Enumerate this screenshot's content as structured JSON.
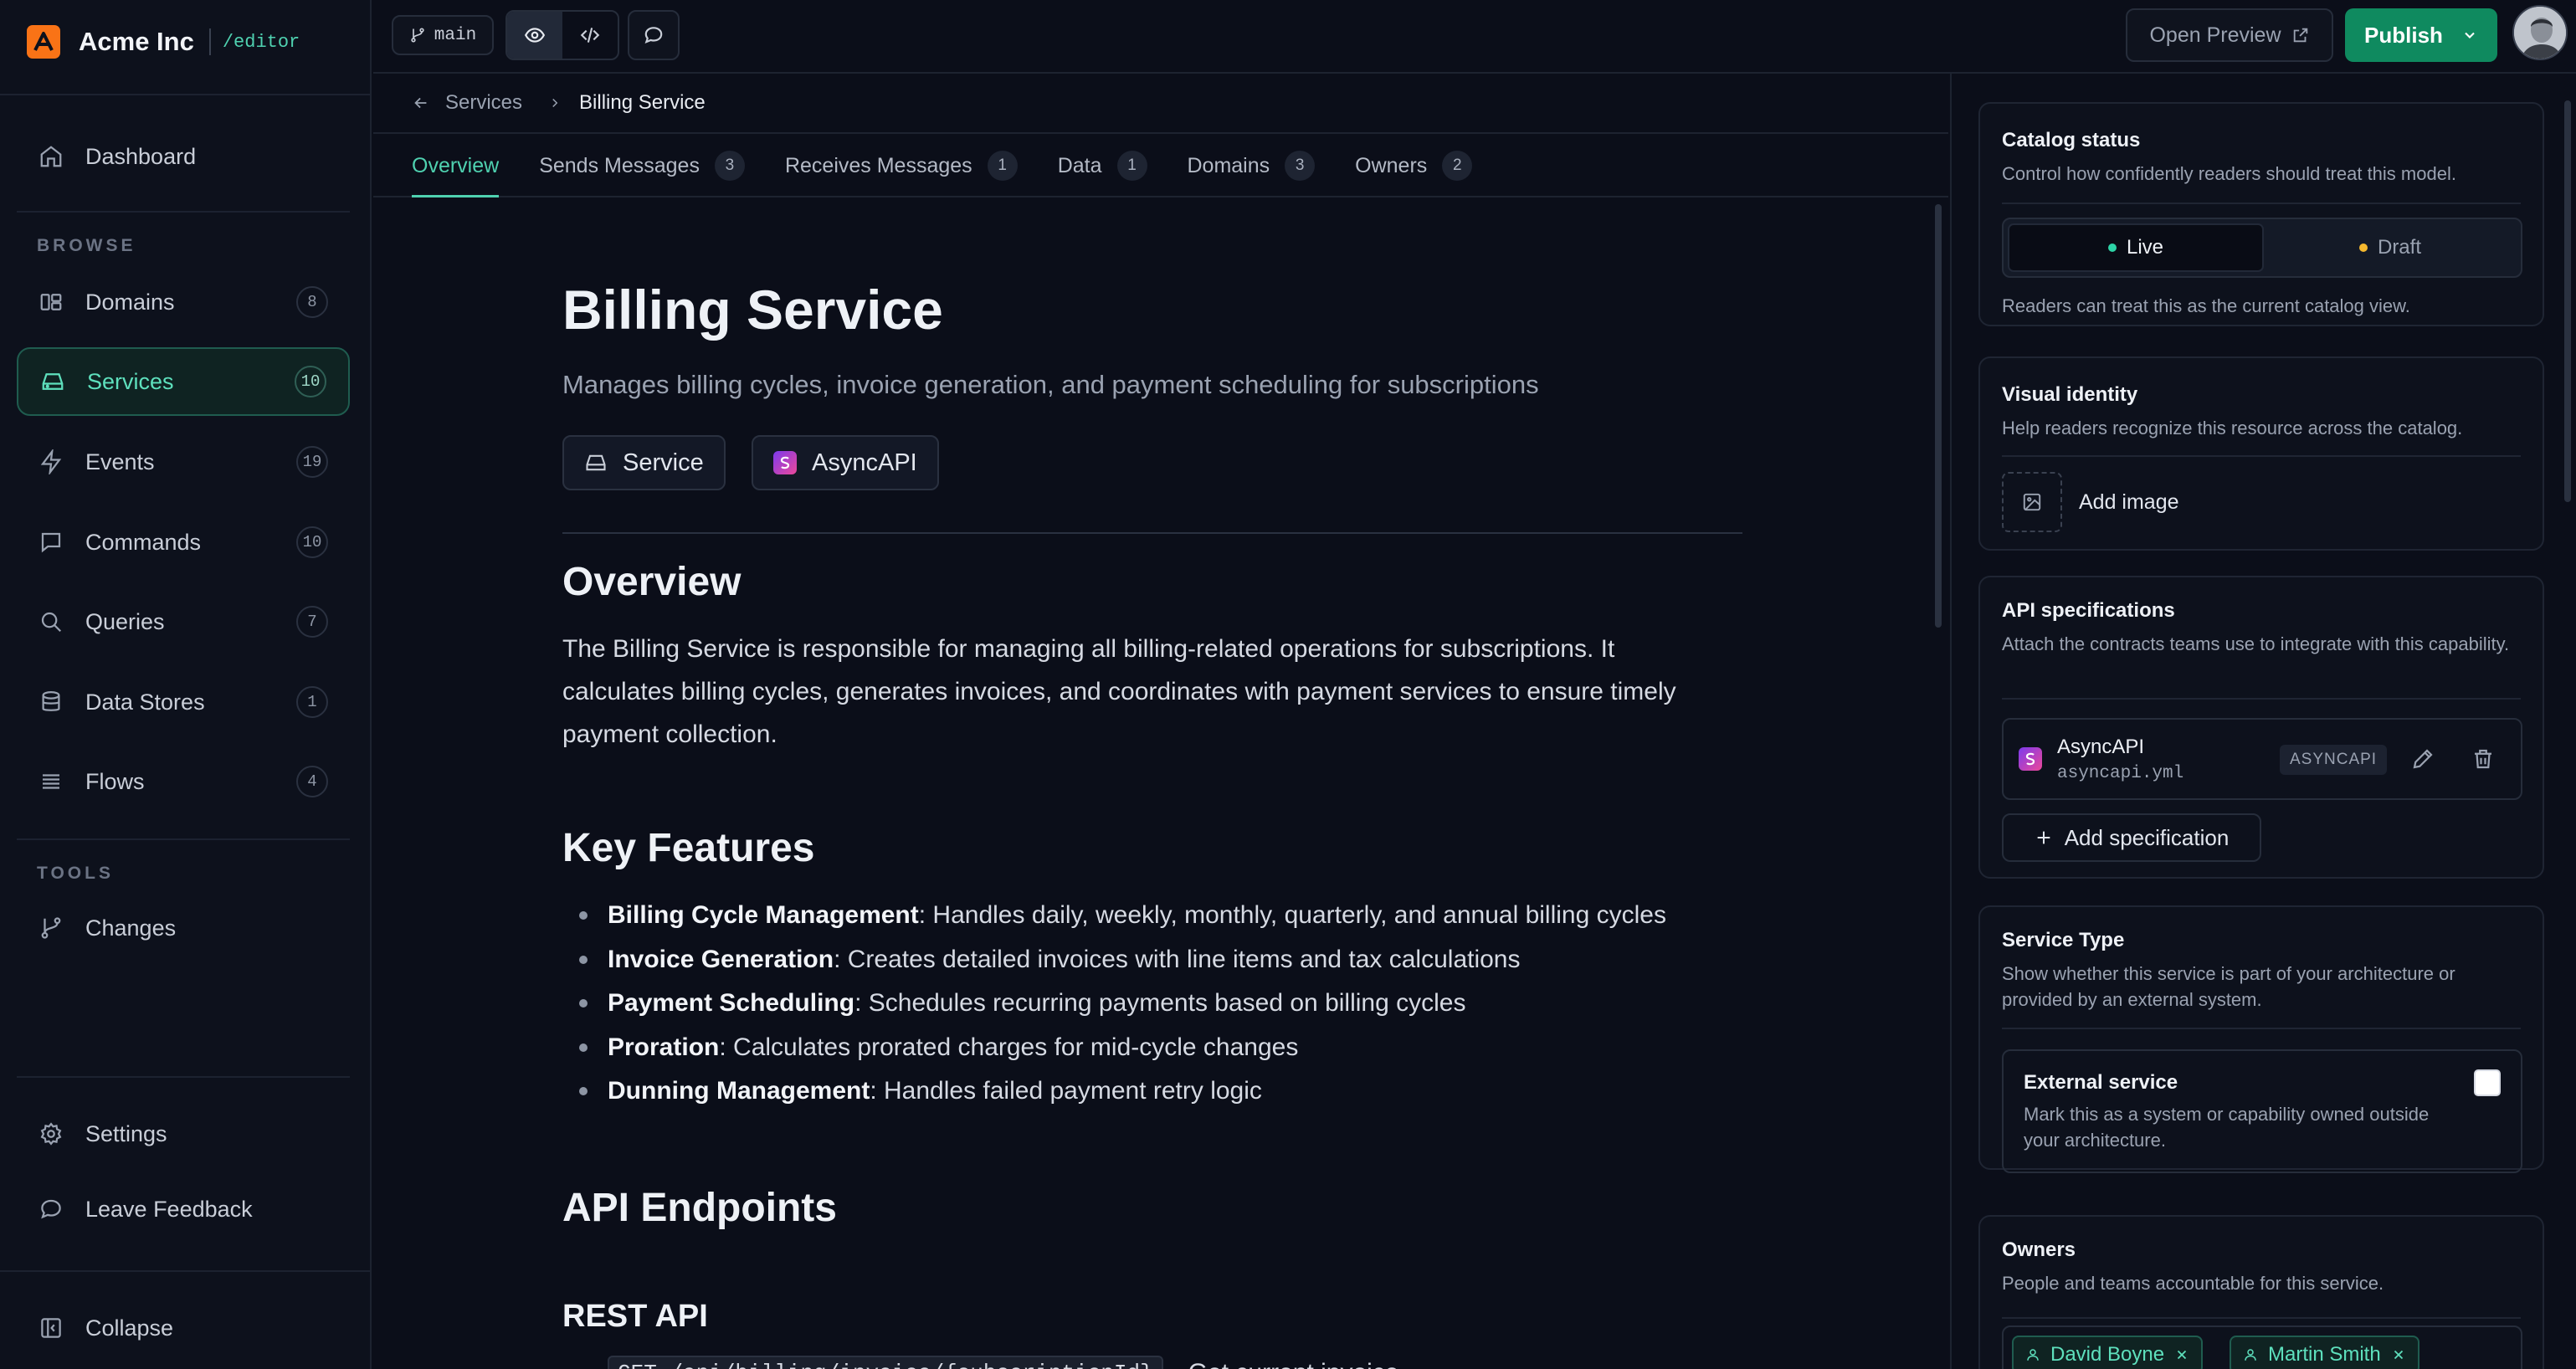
{
  "brand": {
    "name": "Acme Inc",
    "path": "/editor"
  },
  "sidebar": {
    "dashboard": "Dashboard",
    "browse_heading": "BROWSE",
    "items": [
      {
        "label": "Domains",
        "count": "8"
      },
      {
        "label": "Services",
        "count": "10"
      },
      {
        "label": "Events",
        "count": "19"
      },
      {
        "label": "Commands",
        "count": "10"
      },
      {
        "label": "Queries",
        "count": "7"
      },
      {
        "label": "Data Stores",
        "count": "1"
      },
      {
        "label": "Flows",
        "count": "4"
      }
    ],
    "tools_heading": "TOOLS",
    "changes": "Changes",
    "settings": "Settings",
    "feedback": "Leave Feedback",
    "collapse": "Collapse"
  },
  "topbar": {
    "branch": "main",
    "open_preview": "Open Preview",
    "publish": "Publish"
  },
  "breadcrumb": {
    "parent": "Services",
    "current": "Billing Service"
  },
  "tabs": [
    {
      "label": "Overview",
      "count": ""
    },
    {
      "label": "Sends Messages",
      "count": "3"
    },
    {
      "label": "Receives Messages",
      "count": "1"
    },
    {
      "label": "Data",
      "count": "1"
    },
    {
      "label": "Domains",
      "count": "3"
    },
    {
      "label": "Owners",
      "count": "2"
    }
  ],
  "doc": {
    "title": "Billing Service",
    "summary": "Manages billing cycles, invoice generation, and payment scheduling for subscriptions",
    "chips": [
      "Service",
      "AsyncAPI"
    ],
    "overview_heading": "Overview",
    "overview_text": "The Billing Service is responsible for managing all billing-related operations for subscriptions. It calculates billing cycles, generates invoices, and coordinates with payment services to ensure timely payment collection.",
    "features_heading": "Key Features",
    "features": [
      {
        "name": "Billing Cycle Management",
        "text": ": Handles daily, weekly, monthly, quarterly, and annual billing cycles"
      },
      {
        "name": "Invoice Generation",
        "text": ": Creates detailed invoices with line items and tax calculations"
      },
      {
        "name": "Payment Scheduling",
        "text": ": Schedules recurring payments based on billing cycles"
      },
      {
        "name": "Proration",
        "text": ": Calculates prorated charges for mid-cycle changes"
      },
      {
        "name": "Dunning Management",
        "text": ": Handles failed payment retry logic"
      }
    ],
    "api_heading": "API Endpoints",
    "rest_heading": "REST API",
    "endpoint_code": "GET /api/billing/invoice/{subscriptionId}",
    "endpoint_text": "Get current invoice"
  },
  "panel": {
    "catalog": {
      "title": "Catalog status",
      "desc": "Control how confidently readers should treat this model.",
      "live": "Live",
      "draft": "Draft",
      "note": "Readers can treat this as the current catalog view."
    },
    "visual": {
      "title": "Visual identity",
      "desc": "Help readers recognize this resource across the catalog.",
      "add_image": "Add image"
    },
    "api": {
      "title": "API specifications",
      "desc": "Attach the contracts teams use to integrate with this capability.",
      "spec_name": "AsyncAPI",
      "spec_file": "asyncapi.yml",
      "spec_type": "ASYNCAPI",
      "add_spec": "Add specification"
    },
    "service_type": {
      "title": "Service Type",
      "desc": "Show whether this service is part of your architecture or provided by an external system.",
      "ext_title": "External service",
      "ext_desc": "Mark this as a system or capability owned outside your architecture."
    },
    "owners": {
      "title": "Owners",
      "desc": "People and teams accountable for this service.",
      "list": [
        "David Boyne",
        "Martin Smith"
      ]
    }
  },
  "colors": {
    "accent": "#4fd1b0",
    "publish": "#0f8a5f",
    "live_dot": "#2dd4a7",
    "draft_dot": "#f5b82e",
    "brand": "#f97316"
  }
}
